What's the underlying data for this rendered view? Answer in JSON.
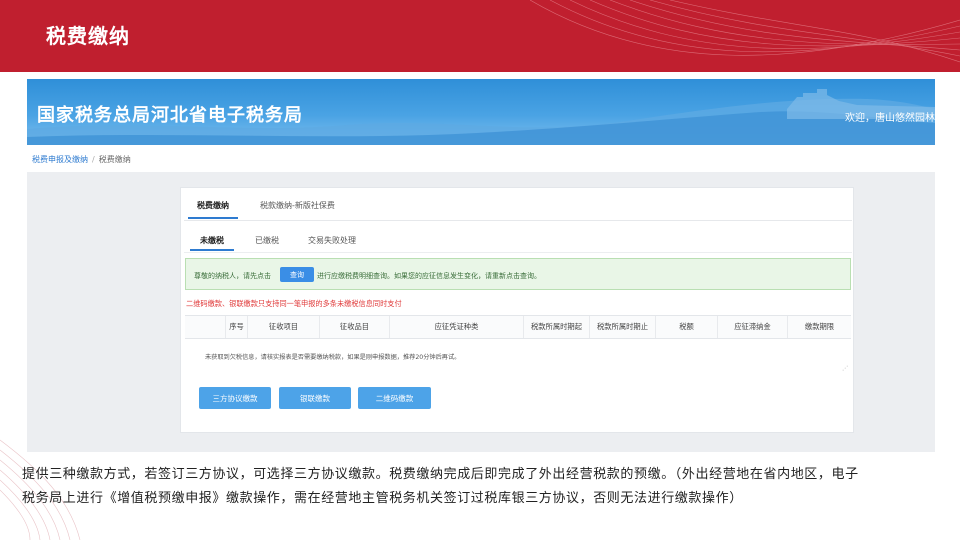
{
  "slide": {
    "title": "税费缴纳"
  },
  "banner": {
    "title": "国家税务总局河北省电子税务局",
    "welcome": "欢迎，唐山悠然园林绿化"
  },
  "breadcrumb": {
    "items": [
      "税费申报及缴纳",
      "税费缴纳"
    ]
  },
  "tabs": [
    {
      "label": "税费缴纳"
    },
    {
      "label": "税款缴纳-新版社保费"
    }
  ],
  "subtabs": [
    {
      "label": "未缴税"
    },
    {
      "label": "已缴税"
    },
    {
      "label": "交易失败处理"
    }
  ],
  "notice": {
    "prefix": "尊敬的纳税人，请先点击",
    "button": "查询",
    "suffix": "进行应缴税费明细查询。如果您的应征信息发生变化，请重新点击查询。"
  },
  "warning": "二维码缴款、银联缴款只支持同一笔申报的多条未缴税信息同时支付",
  "table": {
    "columns": [
      "序号",
      "征收项目",
      "征收品目",
      "应征凭证种类",
      "税款所属时期起",
      "税款所属时期止",
      "税额",
      "应征滞纳金",
      "缴款期限"
    ],
    "empty_message": "未获取到欠税信息，请核实报表是否需要缴纳税款，如果是刚申报数据，推荐20分钟后再试。"
  },
  "buttons": {
    "three_party": "三方协议缴款",
    "unionpay": "银联缴款",
    "qrcode": "二维码缴款"
  },
  "caption": "提供三种缴款方式，若签订三方协议，可选择三方协议缴款。税费缴纳完成后即完成了外出经营税款的预缴。（外出经营地在省内地区，电子税务局上进行《增值税预缴申报》缴款操作，需在经营地主管税务机关签订过税库银三方协议，否则无法进行缴款操作）",
  "colors": {
    "brand_red": "#c01f2f",
    "banner_blue": "#2f8fd8",
    "button_blue": "#4da3e8",
    "warning_red": "#e03a3a"
  }
}
